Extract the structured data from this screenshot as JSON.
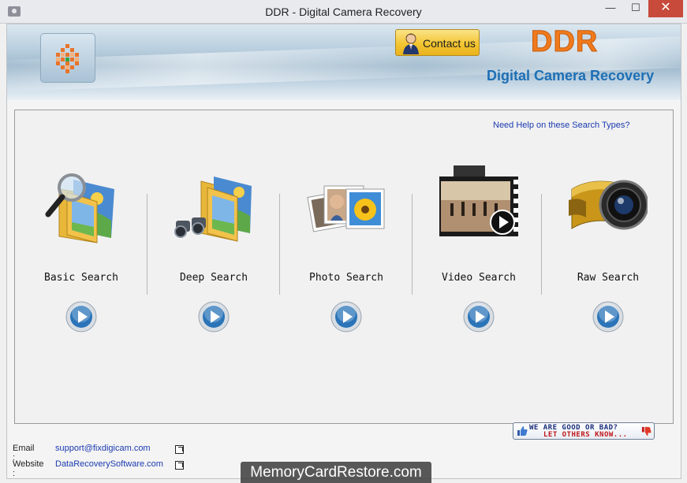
{
  "window": {
    "title": "DDR - Digital Camera Recovery",
    "min_glyph": "—",
    "max_glyph": "☐",
    "close_glyph": "✕"
  },
  "header": {
    "contact_label": "Contact us",
    "brand": "DDR",
    "brand_subtitle": "Digital Camera Recovery"
  },
  "panel": {
    "help_link": "Need Help on these Search Types?",
    "searches": [
      {
        "label": "Basic Search",
        "icon": "magnifier-folder-icon"
      },
      {
        "label": "Deep Search",
        "icon": "binoculars-folder-icon"
      },
      {
        "label": "Photo Search",
        "icon": "photos-icon"
      },
      {
        "label": "Video Search",
        "icon": "filmstrip-icon"
      },
      {
        "label": "Raw Search",
        "icon": "camera-lens-film-icon"
      }
    ]
  },
  "footer": {
    "email_label": "Email :",
    "email_value": "support@fixdigicam.com",
    "website_label": "Website :",
    "website_value": "DataRecoverySoftware.com",
    "feedback_line1": "WE ARE GOOD OR BAD?",
    "feedback_line2": "LET OTHERS KNOW..."
  },
  "watermark": "MemoryCardRestore.com",
  "colors": {
    "brand_orange": "#f07a1c",
    "brand_blue": "#1d6fb5",
    "link_blue": "#1b3bb0",
    "close_red": "#c74a3a"
  }
}
